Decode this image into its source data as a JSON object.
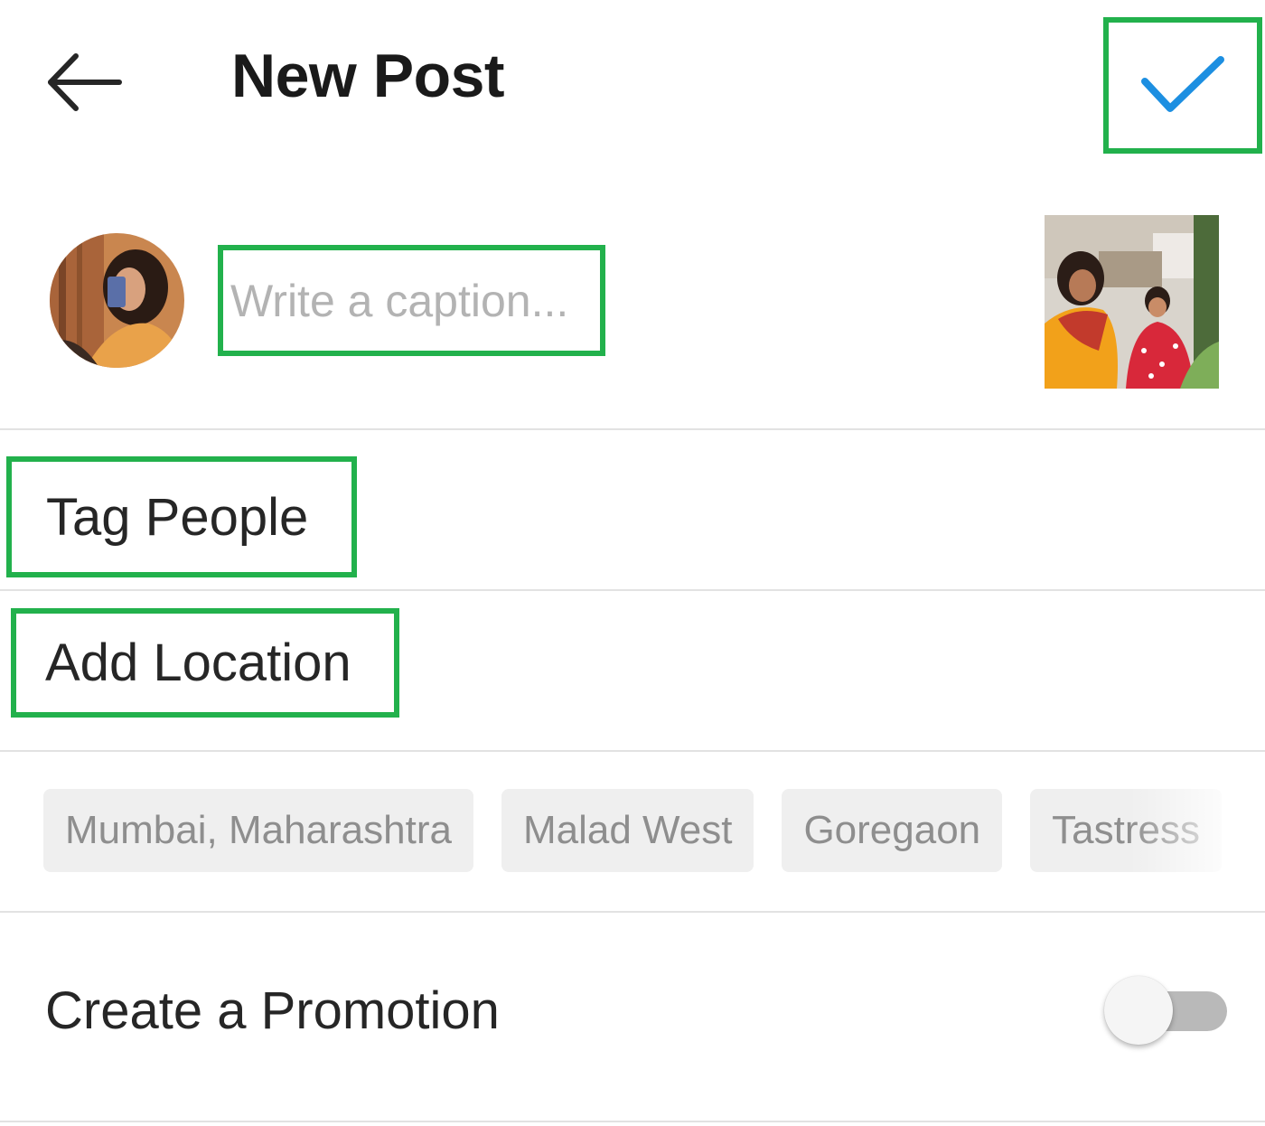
{
  "header": {
    "back_icon": "arrow-left-icon",
    "title": "New Post",
    "confirm_icon": "checkmark-icon"
  },
  "composer": {
    "avatar_icon": "user-avatar",
    "caption_placeholder": "Write a caption...",
    "caption_value": "",
    "thumbnail_icon": "post-photo-thumbnail"
  },
  "options": {
    "tag_people": "Tag People",
    "add_location": "Add Location",
    "location_suggestions": [
      "Mumbai, Maharashtra",
      "Malad West",
      "Goregaon",
      "Tastress"
    ],
    "create_promotion": "Create a Promotion",
    "promotion_enabled": false
  },
  "colors": {
    "highlight": "#22b14c",
    "accent": "#1d8fe1",
    "chip_bg": "#efefef",
    "chip_text": "#8e8e8e",
    "placeholder": "#b3b3b3"
  }
}
